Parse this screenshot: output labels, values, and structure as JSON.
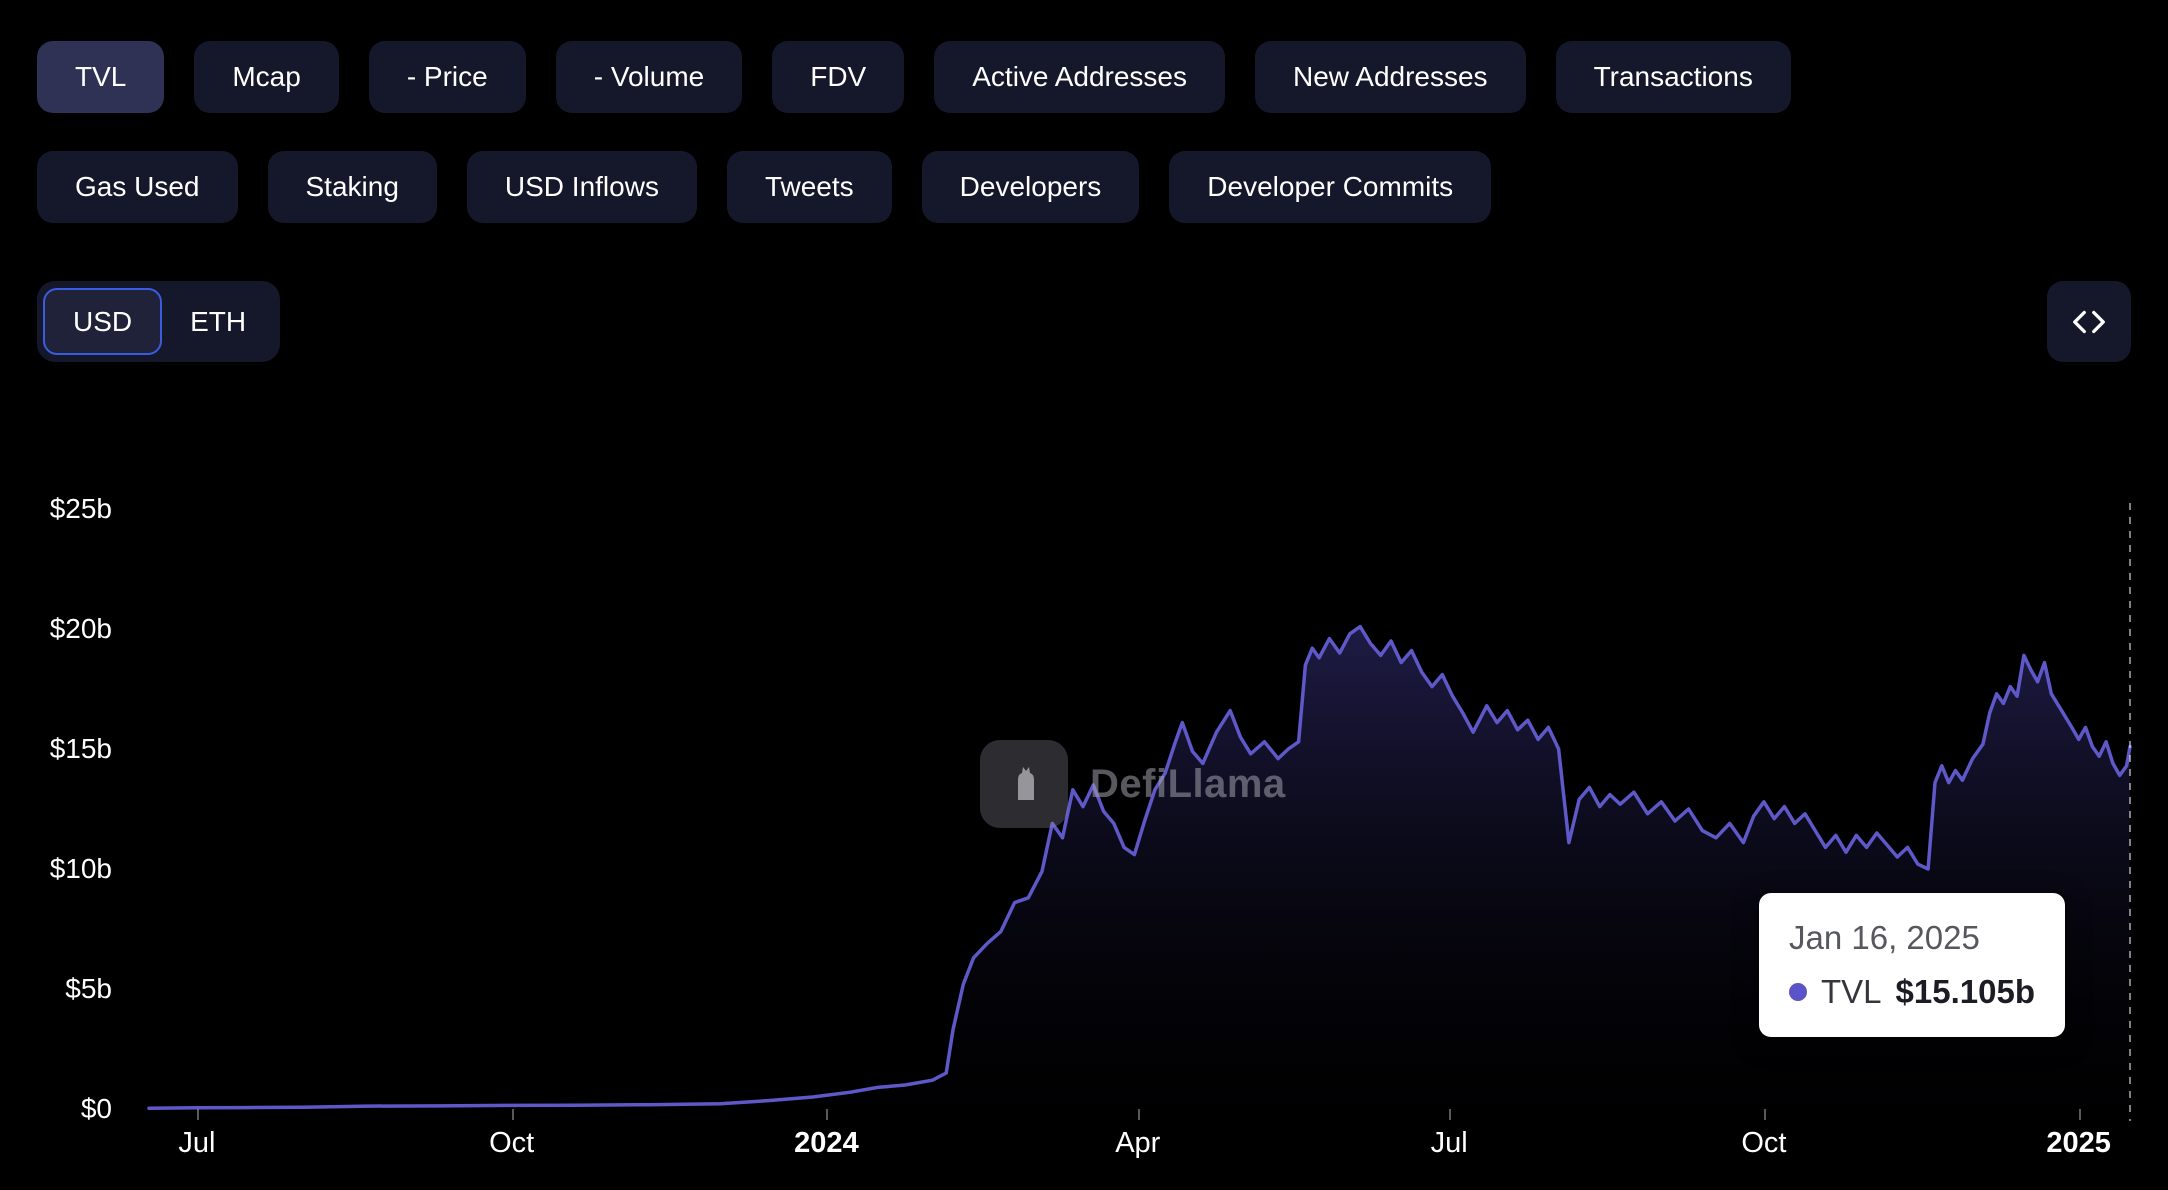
{
  "tabs": {
    "row1": [
      {
        "label": "TVL",
        "active": true
      },
      {
        "label": "Mcap"
      },
      {
        "label": "- Price"
      },
      {
        "label": "- Volume"
      },
      {
        "label": "FDV"
      },
      {
        "label": "Active Addresses"
      },
      {
        "label": "New Addresses"
      },
      {
        "label": "Transactions"
      }
    ],
    "row2": [
      {
        "label": "Gas Used"
      },
      {
        "label": "Staking"
      },
      {
        "label": "USD Inflows"
      },
      {
        "label": "Tweets"
      },
      {
        "label": "Developers"
      },
      {
        "label": "Developer Commits"
      }
    ]
  },
  "currency": {
    "options": [
      "USD",
      "ETH"
    ],
    "selected": "USD"
  },
  "watermark": {
    "text": "DefiLlama"
  },
  "tooltip": {
    "date": "Jan 16, 2025",
    "series": "TVL",
    "value": "$15.105b"
  },
  "colors": {
    "background": "#000000",
    "pill_bg": "#15172b",
    "pill_active_bg": "#2f3254",
    "accent_blue": "#3b5cde",
    "line": "#5f58c9",
    "tooltip_dot": "#5b53c8",
    "tooltip_bg": "#ffffff"
  },
  "chart_data": {
    "type": "area",
    "title": "",
    "xlabel": "",
    "ylabel": "",
    "ylim": [
      0,
      25
    ],
    "x_range": [
      "2023-06-17",
      "2025-01-16"
    ],
    "grid": false,
    "legend": false,
    "crosshair_date": "2025-01-16",
    "y_ticks": [
      {
        "label": "$25b",
        "value": 25
      },
      {
        "label": "$20b",
        "value": 20
      },
      {
        "label": "$15b",
        "value": 15
      },
      {
        "label": "$10b",
        "value": 10
      },
      {
        "label": "$5b",
        "value": 5
      },
      {
        "label": "$0",
        "value": 0
      }
    ],
    "x_ticks": [
      {
        "label": "Jul",
        "date": "2023-07-01"
      },
      {
        "label": "Oct",
        "date": "2023-10-01"
      },
      {
        "label": "2024",
        "date": "2024-01-01",
        "bold": true
      },
      {
        "label": "Apr",
        "date": "2024-04-01"
      },
      {
        "label": "Jul",
        "date": "2024-07-01"
      },
      {
        "label": "Oct",
        "date": "2024-10-01"
      },
      {
        "label": "2025",
        "date": "2025-01-01",
        "bold": true
      }
    ],
    "series": [
      {
        "name": "TVL",
        "color": "#5f58c9",
        "points": [
          [
            "2023-06-17",
            0.03
          ],
          [
            "2023-07-01",
            0.05
          ],
          [
            "2023-07-15",
            0.06
          ],
          [
            "2023-08-01",
            0.07
          ],
          [
            "2023-08-20",
            0.12
          ],
          [
            "2023-09-10",
            0.13
          ],
          [
            "2023-10-01",
            0.15
          ],
          [
            "2023-10-20",
            0.16
          ],
          [
            "2023-11-10",
            0.18
          ],
          [
            "2023-12-01",
            0.22
          ],
          [
            "2023-12-15",
            0.35
          ],
          [
            "2023-12-28",
            0.5
          ],
          [
            "2024-01-08",
            0.7
          ],
          [
            "2024-01-16",
            0.9
          ],
          [
            "2024-01-24",
            1.0
          ],
          [
            "2024-02-01",
            1.2
          ],
          [
            "2024-02-05",
            1.5
          ],
          [
            "2024-02-07",
            3.3
          ],
          [
            "2024-02-10",
            5.2
          ],
          [
            "2024-02-13",
            6.3
          ],
          [
            "2024-02-17",
            6.9
          ],
          [
            "2024-02-21",
            7.4
          ],
          [
            "2024-02-25",
            8.6
          ],
          [
            "2024-02-29",
            8.8
          ],
          [
            "2024-03-04",
            9.9
          ],
          [
            "2024-03-07",
            11.9
          ],
          [
            "2024-03-10",
            11.3
          ],
          [
            "2024-03-13",
            13.3
          ],
          [
            "2024-03-16",
            12.6
          ],
          [
            "2024-03-19",
            13.5
          ],
          [
            "2024-03-22",
            12.4
          ],
          [
            "2024-03-25",
            11.9
          ],
          [
            "2024-03-28",
            10.9
          ],
          [
            "2024-03-31",
            10.6
          ],
          [
            "2024-04-03",
            12.0
          ],
          [
            "2024-04-06",
            13.3
          ],
          [
            "2024-04-09",
            14.0
          ],
          [
            "2024-04-12",
            15.3
          ],
          [
            "2024-04-14",
            16.1
          ],
          [
            "2024-04-17",
            14.9
          ],
          [
            "2024-04-20",
            14.4
          ],
          [
            "2024-04-24",
            15.7
          ],
          [
            "2024-04-28",
            16.6
          ],
          [
            "2024-05-01",
            15.5
          ],
          [
            "2024-05-04",
            14.8
          ],
          [
            "2024-05-08",
            15.3
          ],
          [
            "2024-05-12",
            14.6
          ],
          [
            "2024-05-15",
            15.0
          ],
          [
            "2024-05-18",
            15.3
          ],
          [
            "2024-05-20",
            18.5
          ],
          [
            "2024-05-22",
            19.2
          ],
          [
            "2024-05-24",
            18.8
          ],
          [
            "2024-05-27",
            19.6
          ],
          [
            "2024-05-30",
            19.0
          ],
          [
            "2024-06-02",
            19.8
          ],
          [
            "2024-06-05",
            20.1
          ],
          [
            "2024-06-08",
            19.4
          ],
          [
            "2024-06-11",
            18.9
          ],
          [
            "2024-06-14",
            19.5
          ],
          [
            "2024-06-17",
            18.6
          ],
          [
            "2024-06-20",
            19.1
          ],
          [
            "2024-06-23",
            18.2
          ],
          [
            "2024-06-26",
            17.6
          ],
          [
            "2024-06-29",
            18.1
          ],
          [
            "2024-07-02",
            17.2
          ],
          [
            "2024-07-05",
            16.5
          ],
          [
            "2024-07-08",
            15.7
          ],
          [
            "2024-07-12",
            16.8
          ],
          [
            "2024-07-15",
            16.1
          ],
          [
            "2024-07-18",
            16.6
          ],
          [
            "2024-07-21",
            15.8
          ],
          [
            "2024-07-24",
            16.2
          ],
          [
            "2024-07-27",
            15.4
          ],
          [
            "2024-07-30",
            15.9
          ],
          [
            "2024-08-02",
            15.0
          ],
          [
            "2024-08-05",
            11.1
          ],
          [
            "2024-08-08",
            12.9
          ],
          [
            "2024-08-11",
            13.4
          ],
          [
            "2024-08-14",
            12.6
          ],
          [
            "2024-08-17",
            13.1
          ],
          [
            "2024-08-20",
            12.7
          ],
          [
            "2024-08-24",
            13.2
          ],
          [
            "2024-08-28",
            12.3
          ],
          [
            "2024-09-01",
            12.8
          ],
          [
            "2024-09-05",
            12.0
          ],
          [
            "2024-09-09",
            12.5
          ],
          [
            "2024-09-13",
            11.6
          ],
          [
            "2024-09-17",
            11.3
          ],
          [
            "2024-09-21",
            11.9
          ],
          [
            "2024-09-25",
            11.1
          ],
          [
            "2024-09-28",
            12.2
          ],
          [
            "2024-10-01",
            12.8
          ],
          [
            "2024-10-04",
            12.1
          ],
          [
            "2024-10-07",
            12.6
          ],
          [
            "2024-10-10",
            11.9
          ],
          [
            "2024-10-13",
            12.3
          ],
          [
            "2024-10-16",
            11.6
          ],
          [
            "2024-10-19",
            10.9
          ],
          [
            "2024-10-22",
            11.4
          ],
          [
            "2024-10-25",
            10.7
          ],
          [
            "2024-10-28",
            11.4
          ],
          [
            "2024-10-31",
            10.9
          ],
          [
            "2024-11-03",
            11.5
          ],
          [
            "2024-11-06",
            11.0
          ],
          [
            "2024-11-09",
            10.5
          ],
          [
            "2024-11-12",
            10.9
          ],
          [
            "2024-11-15",
            10.2
          ],
          [
            "2024-11-18",
            10.0
          ],
          [
            "2024-11-20",
            13.6
          ],
          [
            "2024-11-22",
            14.3
          ],
          [
            "2024-11-24",
            13.6
          ],
          [
            "2024-11-26",
            14.1
          ],
          [
            "2024-11-28",
            13.7
          ],
          [
            "2024-12-01",
            14.6
          ],
          [
            "2024-12-04",
            15.2
          ],
          [
            "2024-12-06",
            16.5
          ],
          [
            "2024-12-08",
            17.3
          ],
          [
            "2024-12-10",
            16.9
          ],
          [
            "2024-12-12",
            17.6
          ],
          [
            "2024-12-14",
            17.2
          ],
          [
            "2024-12-16",
            18.9
          ],
          [
            "2024-12-18",
            18.3
          ],
          [
            "2024-12-20",
            17.8
          ],
          [
            "2024-12-22",
            18.6
          ],
          [
            "2024-12-24",
            17.3
          ],
          [
            "2024-12-27",
            16.6
          ],
          [
            "2024-12-30",
            15.9
          ],
          [
            "2025-01-01",
            15.4
          ],
          [
            "2025-01-03",
            15.9
          ],
          [
            "2025-01-05",
            15.1
          ],
          [
            "2025-01-07",
            14.7
          ],
          [
            "2025-01-09",
            15.3
          ],
          [
            "2025-01-11",
            14.4
          ],
          [
            "2025-01-13",
            13.9
          ],
          [
            "2025-01-15",
            14.3
          ],
          [
            "2025-01-16",
            15.105
          ]
        ]
      }
    ]
  }
}
